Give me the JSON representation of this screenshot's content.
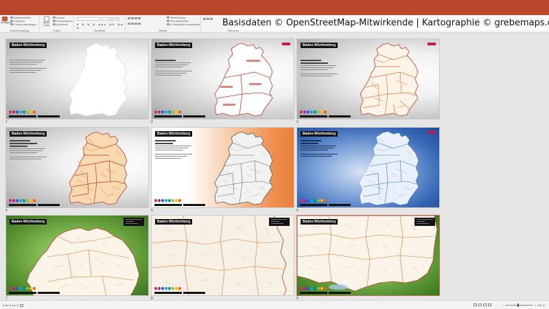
{
  "banner": {
    "text": "Basisdaten © OpenStreetMap-Mitwirkende | Kartographie © grebemaps.de"
  },
  "ribbon": {
    "groups": [
      {
        "label": "Zwischenablage",
        "items": [
          "Ausschneiden",
          "Kopieren",
          "Format übertragen"
        ],
        "big": "Einfügen"
      },
      {
        "label": "Folien",
        "items": [
          "Layout",
          "Zurücksetzen",
          "Abschnitt"
        ],
        "big": "Neue Folie"
      },
      {
        "label": "Schriftart",
        "items": []
      },
      {
        "label": "Absatz",
        "items": [
          "Textrichtung",
          "Text ausrichten",
          "In SmartArt konvertieren"
        ]
      },
      {
        "label": "Zeichnen",
        "items": [
          "Anordnen",
          "Schnellformat-vorlagen"
        ]
      },
      {
        "label": "Bearbeiten",
        "items": [
          "Suchen",
          "Ersetzen",
          "Markieren"
        ]
      }
    ]
  },
  "slides": [
    {
      "number": "1",
      "title": "Baden-Württemberg",
      "style": "gray"
    },
    {
      "number": "2",
      "title": "Baden-Württemberg",
      "style": "gray"
    },
    {
      "number": "3",
      "title": "Baden-Württemberg",
      "style": "gray"
    },
    {
      "number": "4",
      "title": "Baden-Württemberg",
      "style": "gray"
    },
    {
      "number": "5",
      "title": "Baden-Württemberg",
      "style": "orange"
    },
    {
      "number": "6",
      "title": "Baden-Württemberg",
      "style": "blue"
    },
    {
      "number": "7",
      "title": "Baden-Württemberg",
      "style": "green"
    },
    {
      "number": "8",
      "title": "Baden-Württemberg",
      "style": "paper"
    },
    {
      "number": "9",
      "title": "Baden-Württemberg",
      "style": "green"
    }
  ],
  "statusbar": {
    "slide_info": "Folie 9 von 9",
    "zoom": "100 %"
  },
  "colors": {
    "accent": "#b7472a",
    "map_orange": "#e8732a",
    "map_red": "#c0392b",
    "pin_colors": [
      "#e91e63",
      "#9c27b0",
      "#3f51b5",
      "#03a9f4",
      "#009688",
      "#8bc34a",
      "#ffc107",
      "#ff5722",
      "#795548",
      "#607d8b"
    ]
  }
}
